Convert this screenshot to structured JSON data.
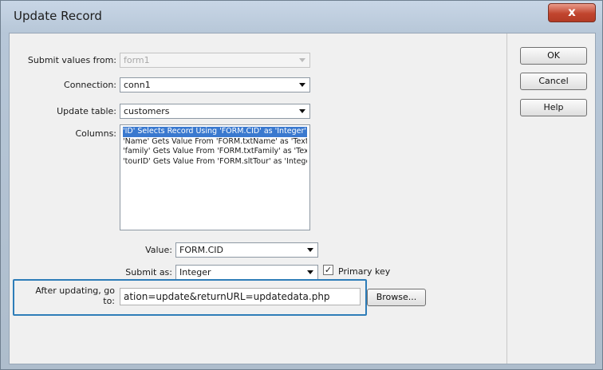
{
  "window": {
    "title": "Update Record",
    "close_glyph": "x"
  },
  "form": {
    "submit_values_from": {
      "label": "Submit values from:",
      "value": "form1"
    },
    "connection": {
      "label": "Connection:",
      "value": "conn1"
    },
    "update_table": {
      "label": "Update table:",
      "value": "customers"
    },
    "columns": {
      "label": "Columns:",
      "items": [
        "'ID' Selects Record Using 'FORM.CID' as 'Integer'",
        "'Name' Gets Value From 'FORM.txtName' as 'Text'",
        "'family' Gets Value From 'FORM.txtFamily' as 'Text'",
        "'tourID' Gets Value From 'FORM.sltTour' as 'Integer'"
      ]
    },
    "value": {
      "label": "Value:",
      "value": "FORM.CID"
    },
    "submit_as": {
      "label": "Submit as:",
      "value": "Integer"
    },
    "primary_key": {
      "label": "Primary key",
      "checked": true,
      "mark": "✓"
    },
    "after_updating": {
      "label_line1": "After updating, go",
      "label_line2": "to:",
      "value": "ation=update&returnURL=updatedata.php"
    }
  },
  "buttons": {
    "ok": "OK",
    "cancel": "Cancel",
    "help": "Help",
    "browse": "Browse..."
  }
}
